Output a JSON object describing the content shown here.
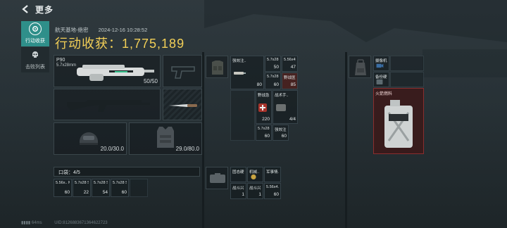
{
  "header": {
    "title": "更多"
  },
  "sidebar": {
    "tabs": [
      {
        "label": "行动收获",
        "icon": "target-icon",
        "active": true
      },
      {
        "label": "击败列表",
        "icon": "skull-icon",
        "active": false
      }
    ]
  },
  "summary": {
    "location": "航天基地-绝密",
    "datetime": "2024-12-16 10:28:52",
    "income_label": "行动收获：",
    "income_value": "1,775,189"
  },
  "loadout": {
    "primary_weapon": {
      "name": "P90",
      "caliber": "5.7x28mm",
      "durability": "50/50"
    },
    "helmet": {
      "durability": "20.0/30.0"
    },
    "armor": {
      "durability": "29.0/80.0"
    }
  },
  "pocket": {
    "label": "口袋：4/5",
    "items": [
      {
        "name": "5.56x.. M855",
        "count": "60"
      },
      {
        "name": "5.7x28 SS190",
        "count": "22"
      },
      {
        "name": "5.7x28 SS190",
        "count": "54"
      },
      {
        "name": "5.7x28 SS190",
        "count": "60"
      }
    ]
  },
  "chest_rig": {
    "items": [
      {
        "name": "强效注..",
        "count": "80"
      },
      {
        "name": "5.7x28 SS190",
        "count": "60"
      },
      {
        "name": "5.7x28 SS197SR",
        "count": "50"
      },
      {
        "name": "5.56x45 M855A1",
        "count": "47"
      },
      {
        "name": "5.7x28 SS190",
        "count": "60"
      },
      {
        "name": "野战医..",
        "count": "85"
      },
      {
        "name": "野战急..",
        "count": "220"
      },
      {
        "name": "战术手..",
        "count": "4/4"
      },
      {
        "name": "5.7x28 SS190",
        "count": "60"
      },
      {
        "name": "强效注..",
        "count": "60"
      }
    ],
    "lower_items": [
      {
        "name": "固态硬..",
        "count": ""
      },
      {
        "name": "机械..",
        "count": ""
      },
      {
        "name": "军事情..",
        "count": ""
      },
      {
        "name": "战斗兴..",
        "count": "1"
      },
      {
        "name": "战斗兴..",
        "count": "1"
      },
      {
        "name": "5.56x4..",
        "count": "60"
      }
    ]
  },
  "backpack": {
    "items": [
      {
        "name": "摄像机",
        "count": ""
      },
      {
        "name": "备份硬..",
        "count": ""
      },
      {
        "name": "火箭燃料",
        "count": ""
      }
    ]
  },
  "footer": {
    "ping": "64ms",
    "uid": "UID:8126883671364622723"
  },
  "colors": {
    "accent": "#2f8f8a",
    "income": "#f2cf57",
    "rare_red": "#8a2e2e"
  }
}
